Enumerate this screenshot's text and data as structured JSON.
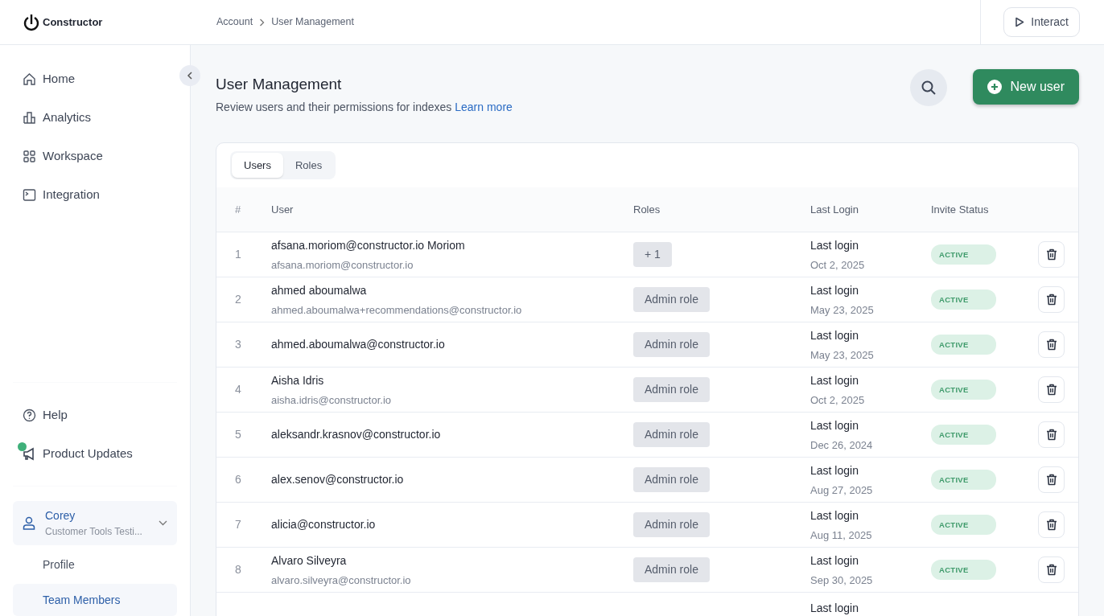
{
  "header": {
    "logo": "Constructor",
    "breadcrumb": [
      {
        "label": "Account"
      },
      {
        "label": "User Management"
      }
    ],
    "interact_button": "Interact"
  },
  "sidebar": {
    "nav": [
      {
        "label": "Home"
      },
      {
        "label": "Analytics"
      },
      {
        "label": "Workspace"
      },
      {
        "label": "Integration"
      }
    ],
    "footer_items": [
      {
        "label": "Help",
        "has_update": false
      },
      {
        "label": "Product Updates",
        "has_update": true
      }
    ],
    "account": {
      "name": "Corey",
      "org": "Customer Tools Testi...",
      "expanded": true
    },
    "account_links": [
      {
        "label": "Profile",
        "selected": false
      },
      {
        "label": "Team Members",
        "selected": true
      }
    ]
  },
  "page": {
    "title": "User Management",
    "subtitle": "Review users and their permissions for indexes",
    "learn_more": "Learn more",
    "new_user_button": "New user"
  },
  "tabs": [
    {
      "label": "Users",
      "selected": true
    },
    {
      "label": "Roles",
      "selected": false
    }
  ],
  "table": {
    "columns": [
      "#",
      "User",
      "Roles",
      "Last Login",
      "Invite Status"
    ],
    "rows": [
      {
        "index": "1",
        "name": "afsana.moriom@constructor.io Moriom",
        "email": "afsana.moriom@constructor.io",
        "role": "+ 1",
        "last_login_label": "Last login",
        "last_login_date": "Oct 2, 2025",
        "status": "ACTIVE"
      },
      {
        "index": "2",
        "name": "ahmed aboumalwa",
        "email": "ahmed.aboumalwa+recommendations@constructor.io",
        "role": "Admin role",
        "last_login_label": "Last login",
        "last_login_date": "May 23, 2025",
        "status": "ACTIVE"
      },
      {
        "index": "3",
        "name": "ahmed.aboumalwa@constructor.io",
        "role": "Admin role",
        "last_login_label": "Last login",
        "last_login_date": "May 23, 2025",
        "status": "ACTIVE"
      },
      {
        "index": "4",
        "name": "Aisha Idris",
        "email": "aisha.idris@constructor.io",
        "role": "Admin role",
        "last_login_label": "Last login",
        "last_login_date": "Oct 2, 2025",
        "status": "ACTIVE"
      },
      {
        "index": "5",
        "name": "aleksandr.krasnov@constructor.io",
        "role": "Admin role",
        "last_login_label": "Last login",
        "last_login_date": "Dec 26, 2024",
        "status": "ACTIVE"
      },
      {
        "index": "6",
        "name": "alex.senov@constructor.io",
        "role": "Admin role",
        "last_login_label": "Last login",
        "last_login_date": "Aug 27, 2025",
        "status": "ACTIVE"
      },
      {
        "index": "7",
        "name": "alicia@constructor.io",
        "role": "Admin role",
        "last_login_label": "Last login",
        "last_login_date": "Aug 11, 2025",
        "status": "ACTIVE"
      },
      {
        "index": "8",
        "name": "Alvaro Silveyra",
        "email": "alvaro.silveyra@constructor.io",
        "role": "Admin role",
        "last_login_label": "Last login",
        "last_login_date": "Sep 30, 2025",
        "status": "ACTIVE"
      },
      {
        "last_login_label": "Last login"
      }
    ]
  }
}
